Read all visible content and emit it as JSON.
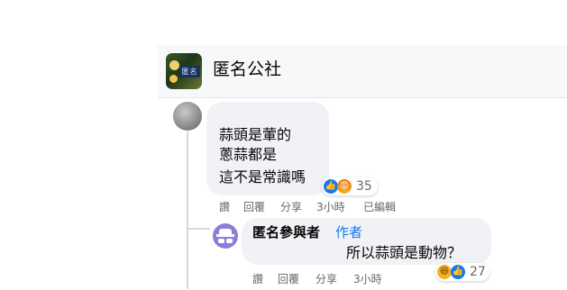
{
  "group": {
    "name": "匿名公社",
    "avatar_text": "匿名"
  },
  "comment": {
    "lines": [
      "蒜頭是葷的",
      "蔥蒜都是",
      "這不是常識嗎"
    ],
    "reactions": {
      "icons": [
        "like-icon",
        "angry-icon"
      ],
      "count": "35"
    },
    "actions": {
      "like": "讚",
      "reply": "回覆",
      "share": "分享",
      "time": "3小時",
      "edited": "已編輯"
    }
  },
  "reply": {
    "author": "匿名參與者",
    "author_badge": "作者",
    "text": "所以蒜頭是動物？",
    "reactions": {
      "icons": [
        "haha-icon",
        "like-icon"
      ],
      "count": "27"
    },
    "actions": {
      "like": "讚",
      "reply": "回覆",
      "share": "分享",
      "time": "3小時"
    }
  },
  "colors": {
    "bubble": "#f0f2f5",
    "meta": "#65676b",
    "accent": "#1877f2"
  }
}
